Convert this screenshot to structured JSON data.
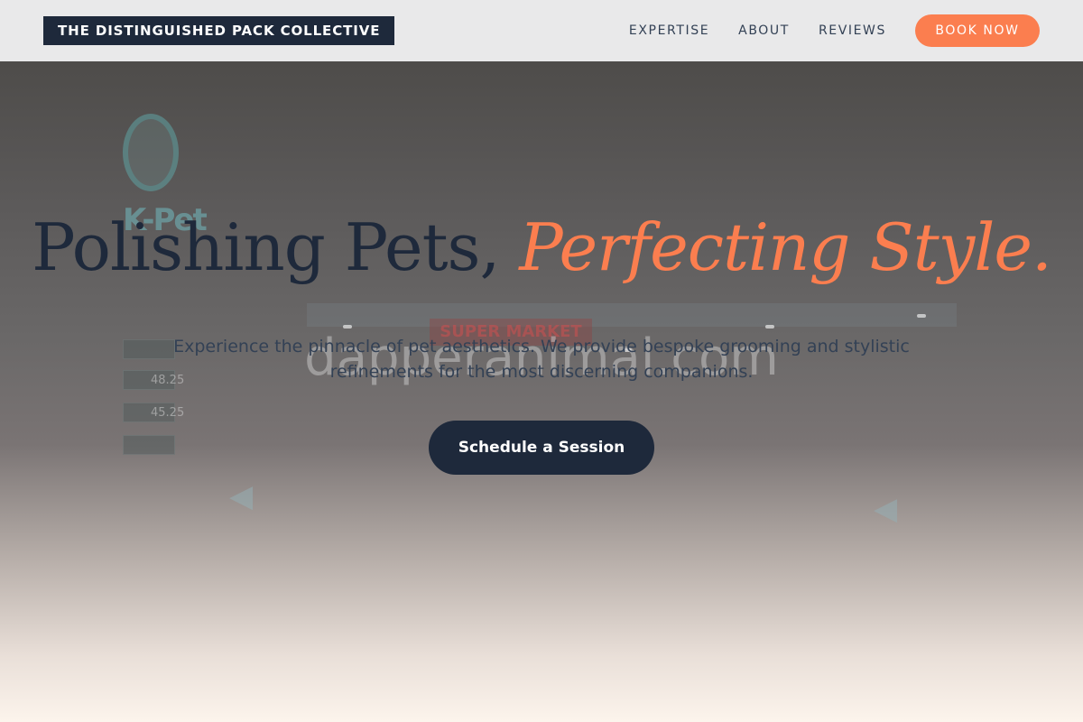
{
  "nav": {
    "brand": "THE DISTINGUISHED PACK COLLECTIVE",
    "links": [
      "EXPERTISE",
      "ABOUT",
      "REVIEWS"
    ],
    "book_label": "BOOK NOW"
  },
  "hero": {
    "headline_main": "Polishing Pets,",
    "headline_accent": "Perfecting Style.",
    "subtext": "Experience the pinnacle of pet aesthetics. We provide bespoke grooming and stylistic refinements for the most discerning companions.",
    "cta_label": "Schedule a Session",
    "background": {
      "sign_text": "K-Pet",
      "store_sign_text": "SUPER MARKET",
      "watermark": "dapperanimal.com",
      "prices": [
        "48.25",
        "45.25"
      ]
    }
  },
  "colors": {
    "navy": "#1e293b",
    "accent": "#fb7e4f",
    "nav_bg": "#e9e9ea"
  }
}
